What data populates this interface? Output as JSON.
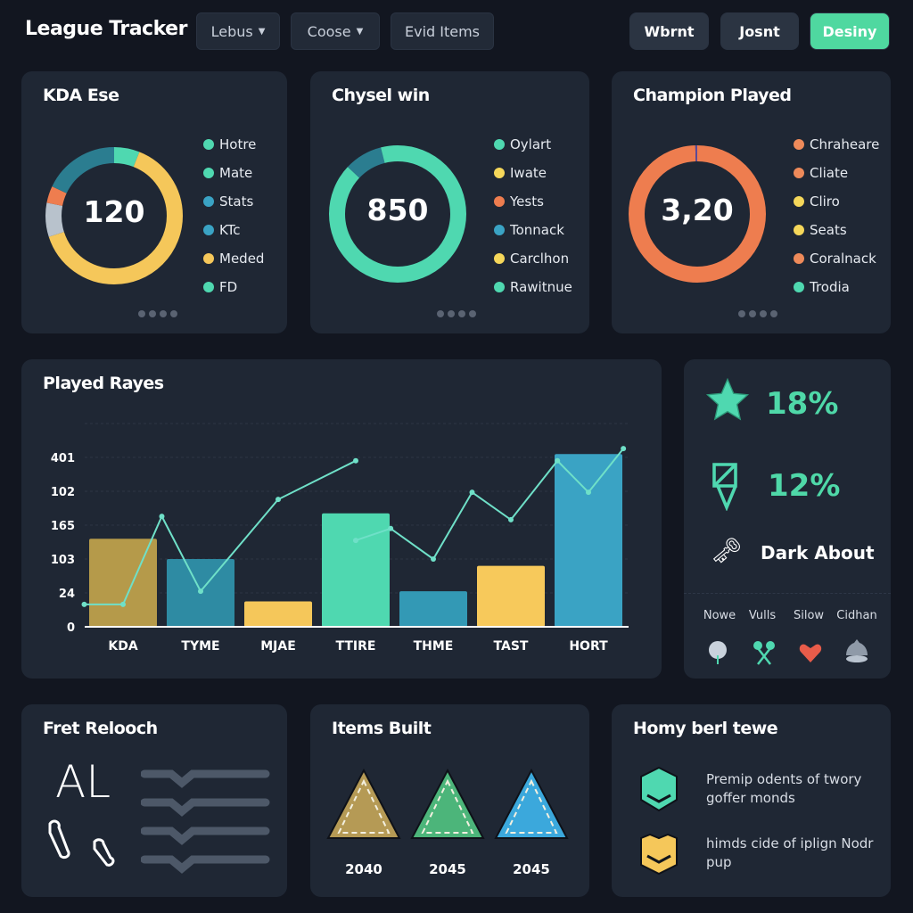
{
  "header": {
    "title": "League Tracker",
    "dropdowns": [
      {
        "label": "Lebus"
      },
      {
        "label": "Coose"
      }
    ],
    "filter_label": "Evid Items",
    "actions": [
      {
        "label": "Wbrnt"
      },
      {
        "label": "Josnt"
      },
      {
        "label": "Desiny"
      }
    ]
  },
  "colors": {
    "teal": "#4fd8b0",
    "yellow": "#f5c75a",
    "orange": "#ee7d4f",
    "blue": "#3aa3c4",
    "dark_teal": "#2b7d90",
    "background": "#121620",
    "card": "#1f2734"
  },
  "donut_cards": [
    {
      "title": "KDA Ese",
      "value": "120",
      "segments": [
        {
          "color": "#4fd8b0",
          "fraction": 0.06
        },
        {
          "color": "#f5c75a",
          "fraction": 0.64
        },
        {
          "color": "#b8c2cc",
          "fraction": 0.08
        },
        {
          "color": "#ee7d4f",
          "fraction": 0.04
        },
        {
          "color": "#2b7d90",
          "fraction": 0.18
        }
      ],
      "legend": [
        {
          "label": "Hotre",
          "color": "#4fd8b0"
        },
        {
          "label": "Mate",
          "color": "#4fd8b0"
        },
        {
          "label": "Stats",
          "color": "#3aa3c4"
        },
        {
          "label": "KTc",
          "color": "#3aa3c4"
        },
        {
          "label": "Meded",
          "color": "#f5c75a"
        },
        {
          "label": "FD",
          "color": "#4fd8b0"
        }
      ]
    },
    {
      "title": "Chysel win",
      "value": "850",
      "segments": [
        {
          "color": "#4fd8b0",
          "fraction": 0.87
        },
        {
          "color": "#2b7d90",
          "fraction": 0.09
        },
        {
          "color": "#4fd8b0",
          "fraction": 0.04
        }
      ],
      "legend": [
        {
          "label": "Oylart",
          "color": "#4fd8b0"
        },
        {
          "label": "Iwate",
          "color": "#f5d75a"
        },
        {
          "label": "Yests",
          "color": "#ee7d4f"
        },
        {
          "label": "Tonnack",
          "color": "#3aa3c4"
        },
        {
          "label": "Carclhon",
          "color": "#f5d75a"
        },
        {
          "label": "Rawitnue",
          "color": "#4fd8b0"
        }
      ]
    },
    {
      "title": "Champion Played",
      "value": "3,20",
      "segments": [
        {
          "color": "#ee7d4f",
          "fraction": 0.995
        },
        {
          "color": "#5b4a9a",
          "fraction": 0.005
        }
      ],
      "legend": [
        {
          "label": "Chraheare",
          "color": "#ee8a5a"
        },
        {
          "label": "Cliate",
          "color": "#ee8a5a"
        },
        {
          "label": "Cliro",
          "color": "#f5d75a"
        },
        {
          "label": "Seats",
          "color": "#f5d75a"
        },
        {
          "label": "Coralnack",
          "color": "#ee8a5a"
        },
        {
          "label": "Trodia",
          "color": "#4fd8b0"
        }
      ]
    }
  ],
  "chart_data": {
    "type": "bar",
    "title": "Played Rayes",
    "categories": [
      "KDA",
      "TYME",
      "MJAE",
      "TTIRE",
      "THME",
      "TAST",
      "HORT"
    ],
    "y_tick_labels": [
      "0",
      "24",
      "103",
      "165",
      "102",
      "401"
    ],
    "values_in_tick_steps": [
      2.6,
      2.0,
      0.75,
      3.35,
      1.05,
      1.8,
      5.1
    ],
    "bar_colors": [
      "#b59a4a",
      "#2e8ba3",
      "#f5c75a",
      "#4fd8b0",
      "#3399b5",
      "#f7c95b",
      "#3aa3c4"
    ],
    "line_series": [
      {
        "points": [
          [
            -0.5,
            0.66
          ],
          [
            0,
            0.66
          ],
          [
            0.5,
            3.26
          ],
          [
            1,
            1.05
          ],
          [
            2,
            3.76
          ],
          [
            3,
            4.9
          ]
        ]
      },
      {
        "points": [
          [
            3,
            2.55
          ],
          [
            3.45,
            2.9
          ],
          [
            4,
            2.0
          ],
          [
            4.5,
            3.97
          ],
          [
            5,
            3.16
          ],
          [
            5.6,
            4.9
          ],
          [
            6,
            3.97
          ],
          [
            6.45,
            5.26
          ]
        ]
      }
    ],
    "line_color": "#6fe0c8",
    "grid": true
  },
  "side_stats": {
    "stats": [
      {
        "value": "18%",
        "icon": "star-icon"
      },
      {
        "value": "12%",
        "icon": "ward-icon"
      }
    ],
    "feature_label": "Dark About",
    "mini": [
      {
        "label": "Nowe",
        "icon": "tree-icon"
      },
      {
        "label": "Vulls",
        "icon": "crossed-icon"
      },
      {
        "label": "Silow",
        "icon": "heart-icon"
      },
      {
        "label": "Cidhan",
        "icon": "bell-icon"
      }
    ]
  },
  "bottom": {
    "runes": {
      "title": "Fret Relooch",
      "glyph": "AL"
    },
    "items": {
      "title": "Items Built",
      "list": [
        {
          "value": "2040",
          "color": "#b59a55"
        },
        {
          "value": "2045",
          "color": "#4cb57a"
        },
        {
          "value": "2045",
          "color": "#3ba8dc"
        }
      ]
    },
    "notes": {
      "title": "Homy berl tewe",
      "list": [
        {
          "text": "Premip odents of twory goffer monds",
          "color": "#4fd8b0"
        },
        {
          "text": "himds cide of iplign Nodr pup",
          "color": "#f5c75a"
        }
      ]
    }
  }
}
